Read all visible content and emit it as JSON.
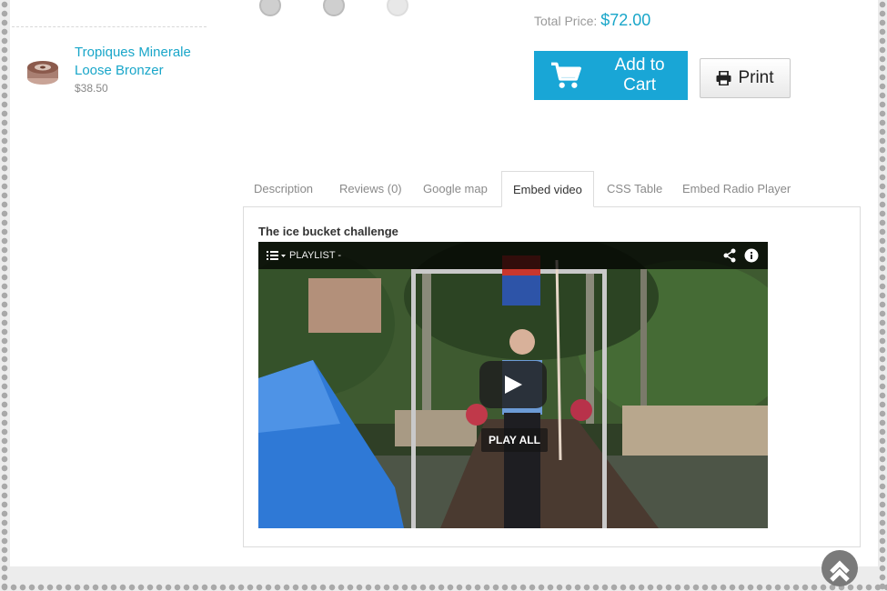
{
  "sidebar": {
    "product": {
      "name": "Tropiques Minerale Loose Bronzer",
      "price": "$38.50"
    }
  },
  "purchase": {
    "total_label": "Total Price:",
    "total_value": "$72.00",
    "add_to_cart_label": "Add to Cart",
    "print_label": "Print"
  },
  "tabs": [
    {
      "label": "Description",
      "active": false
    },
    {
      "label": "Reviews (0)",
      "active": false
    },
    {
      "label": "Google map",
      "active": false
    },
    {
      "label": "Embed video",
      "active": true
    },
    {
      "label": "CSS Table",
      "active": false
    },
    {
      "label": "Embed Radio Player",
      "active": false
    }
  ],
  "video": {
    "title": "The ice bucket challenge",
    "playlist_label": "PLAYLIST -",
    "play_all_label": "PLAY ALL"
  },
  "colors": {
    "accent": "#19a6d6",
    "link": "#19a6c9"
  }
}
